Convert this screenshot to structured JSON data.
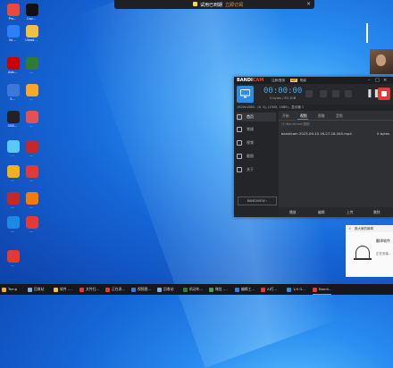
{
  "colors": {
    "accent_blue": "#2f8de4",
    "record_red": "#e53935",
    "timer_blue": "#3fa9f5",
    "trial_orange": "#ff9a3c"
  },
  "trial_banner": {
    "text": "试用已到期",
    "action": "立即订阅",
    "close": "×"
  },
  "desktop_icons": [
    {
      "label": "Pro...",
      "color": "#e84a3c",
      "icon": "app-icon"
    },
    {
      "label": "Cap...",
      "color": "#111111",
      "icon": "capcut-icon"
    },
    {
      "label": "Ke...",
      "color": "#2d7ff9",
      "icon": "app-icon"
    },
    {
      "label": "Ulead...",
      "color": "#f0c040",
      "icon": "app-icon"
    },
    {
      "label": "Ado...",
      "color": "#cc0000",
      "icon": "app-icon"
    },
    {
      "label": "...",
      "color": "#2e7d32",
      "icon": "app-icon"
    },
    {
      "label": "S...",
      "color": "#3c78d8",
      "icon": "app-icon"
    },
    {
      "label": "...",
      "color": "#f9a825",
      "icon": "app-icon"
    },
    {
      "label": "OBS...",
      "color": "#222222",
      "icon": "obs-icon"
    },
    {
      "label": "...",
      "color": "#e65050",
      "icon": "app-icon"
    },
    {
      "label": "...",
      "color": "#5ac8fa",
      "icon": "cloud-icon"
    },
    {
      "label": "...",
      "color": "#c62828",
      "icon": "app-icon"
    },
    {
      "label": "...",
      "color": "#f2b01e",
      "icon": "app-icon"
    },
    {
      "label": "...",
      "color": "#e53935",
      "icon": "app-icon"
    },
    {
      "label": "...",
      "color": "#c62828",
      "icon": "app-icon"
    },
    {
      "label": "...",
      "color": "#f57c00",
      "icon": "app-icon"
    },
    {
      "label": "...",
      "color": "#1e88e5",
      "icon": "app-icon"
    },
    {
      "label": "...",
      "color": "#e53935",
      "icon": "app-icon"
    },
    {
      "label": "...",
      "color": "#e53935",
      "icon": "app-icon"
    }
  ],
  "bandicam": {
    "logo_main": "BANDI",
    "logo_accent": "CAM",
    "register": "注册/登录",
    "vip": "VIP",
    "buy": "购买",
    "timer": "00:00:00",
    "size": "0 bytes / 83.1GB",
    "target": "1920x1080 - (0, 0), (1920, 1080) - 显示器 1",
    "sidebar": [
      {
        "label": "首页",
        "icon": "home-icon"
      },
      {
        "label": "常规",
        "icon": "gear-icon"
      },
      {
        "label": "视频",
        "icon": "video-icon"
      },
      {
        "label": "截图",
        "icon": "image-icon"
      },
      {
        "label": "关于",
        "icon": "info-icon"
      }
    ],
    "sidebar_footer": "BANDIVIEW ›",
    "tabs": [
      "开始",
      "视频",
      "图像",
      "音频"
    ],
    "active_tab": "视频",
    "path": "计:\\Bandicam\\视频",
    "files": [
      {
        "name": "bandicam 2023-09-10 16-27-18-345.mp4",
        "size": "0 bytes"
      }
    ],
    "actions": [
      "播放",
      "编辑",
      "上传",
      "删除"
    ]
  },
  "notifications": {
    "header": "推大家的新闻",
    "title": "翻译软件",
    "subtitle": "正在安装..."
  },
  "taskbar": [
    {
      "label": "Temp",
      "color": "#f0b030"
    },
    {
      "label": "回收站",
      "color": "#88aadd"
    },
    {
      "label": "软件 -...",
      "color": "#f0c040"
    },
    {
      "label": "文件扫...",
      "color": "#e53935"
    },
    {
      "label": "正在说...",
      "color": "#e53935"
    },
    {
      "label": "视频图...",
      "color": "#3c78d8"
    },
    {
      "label": "回收站",
      "color": "#88aadd"
    },
    {
      "label": "机动车...",
      "color": "#2e7d32"
    },
    {
      "label": "微信 -...",
      "color": "#43a047"
    },
    {
      "label": "编辑工...",
      "color": "#3c78d8"
    },
    {
      "label": "AI打...",
      "color": "#e53935"
    },
    {
      "label": "1/4 G...",
      "color": "#2f8de4"
    },
    {
      "label": "Bandi...",
      "color": "#e53935"
    }
  ]
}
